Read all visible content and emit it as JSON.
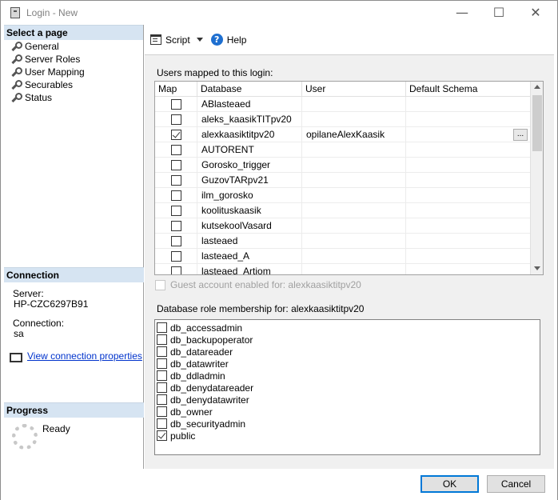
{
  "window": {
    "title": "Login - New",
    "minimize_glyph": "—",
    "maximize_glyph": "☐",
    "close_glyph": "✕"
  },
  "left_pane": {
    "select_page_header": "Select a page",
    "pages": [
      {
        "label": "General",
        "icon": "wrench-icon"
      },
      {
        "label": "Server Roles",
        "icon": "wrench-icon"
      },
      {
        "label": "User Mapping",
        "icon": "wrench-icon"
      },
      {
        "label": "Securables",
        "icon": "wrench-icon"
      },
      {
        "label": "Status",
        "icon": "wrench-icon"
      }
    ],
    "connection_header": "Connection",
    "server_label": "Server:",
    "server_value": "HP-CZC6297B91",
    "connection_label": "Connection:",
    "connection_value": "sa",
    "view_connection_link": "View connection properties",
    "progress_header": "Progress",
    "progress_status": "Ready"
  },
  "toolbar": {
    "script_label": "Script",
    "help_label": "Help"
  },
  "user_mapping": {
    "users_mapped_label": "Users mapped to this login:",
    "columns": [
      "Map",
      "Database",
      "User",
      "Default Schema"
    ],
    "rows": [
      {
        "checked": false,
        "database": "ABlasteaed",
        "user": "",
        "schema": ""
      },
      {
        "checked": false,
        "database": "aleks_kaasikTITpv20",
        "user": "",
        "schema": ""
      },
      {
        "checked": true,
        "database": "alexkaasiktitpv20",
        "user": "opilaneAlexKaasik",
        "schema": "",
        "schema_button": "..."
      },
      {
        "checked": false,
        "database": "AUTORENT",
        "user": "",
        "schema": ""
      },
      {
        "checked": false,
        "database": "Gorosko_trigger",
        "user": "",
        "schema": ""
      },
      {
        "checked": false,
        "database": "GuzovTARpv21",
        "user": "",
        "schema": ""
      },
      {
        "checked": false,
        "database": "ilm_gorosko",
        "user": "",
        "schema": ""
      },
      {
        "checked": false,
        "database": "koolituskaasik",
        "user": "",
        "schema": ""
      },
      {
        "checked": false,
        "database": "kutsekoolVasard",
        "user": "",
        "schema": ""
      },
      {
        "checked": false,
        "database": "lasteaed",
        "user": "",
        "schema": ""
      },
      {
        "checked": false,
        "database": "lasteaed_A",
        "user": "",
        "schema": ""
      },
      {
        "checked": false,
        "database": "lasteaed_Artjom",
        "user": "",
        "schema": ""
      }
    ],
    "guest_label": "Guest account enabled for: alexkaasiktitpv20",
    "role_membership_label": "Database role membership for: alexkaasiktitpv20",
    "roles": [
      {
        "name": "db_accessadmin",
        "checked": false
      },
      {
        "name": "db_backupoperator",
        "checked": false
      },
      {
        "name": "db_datareader",
        "checked": false
      },
      {
        "name": "db_datawriter",
        "checked": false
      },
      {
        "name": "db_ddladmin",
        "checked": false
      },
      {
        "name": "db_denydatareader",
        "checked": false
      },
      {
        "name": "db_denydatawriter",
        "checked": false
      },
      {
        "name": "db_owner",
        "checked": false
      },
      {
        "name": "db_securityadmin",
        "checked": false
      },
      {
        "name": "public",
        "checked": true
      }
    ]
  },
  "footer": {
    "ok_label": "OK",
    "cancel_label": "Cancel"
  }
}
